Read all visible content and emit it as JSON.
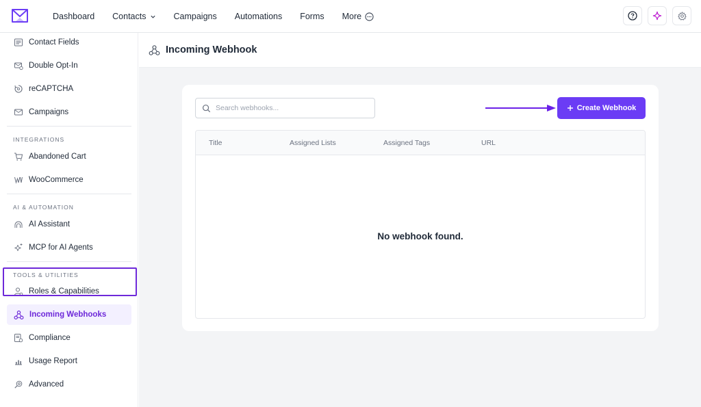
{
  "topnav": {
    "items": [
      {
        "label": "Dashboard"
      },
      {
        "label": "Contacts"
      },
      {
        "label": "Campaigns"
      },
      {
        "label": "Automations"
      },
      {
        "label": "Forms"
      },
      {
        "label": "More"
      }
    ],
    "icons": [
      "help-icon",
      "ai-sparkle-icon",
      "settings-icon"
    ]
  },
  "sidebar": {
    "items_top": [
      {
        "label": "Contact Fields",
        "icon": "contact-fields-icon"
      },
      {
        "label": "Double Opt-In",
        "icon": "double-opt-in-icon"
      },
      {
        "label": "reCAPTCHA",
        "icon": "recaptcha-icon"
      },
      {
        "label": "Campaigns",
        "icon": "envelope-icon"
      }
    ],
    "integrations_heading": "INTEGRATIONS",
    "integrations": [
      {
        "label": "Abandoned Cart",
        "icon": "cart-icon"
      },
      {
        "label": "WooCommerce",
        "icon": "woocommerce-icon"
      }
    ],
    "ai_heading": "AI & AUTOMATION",
    "ai": [
      {
        "label": "AI Assistant",
        "icon": "ai-assistant-icon"
      },
      {
        "label": "MCP for AI Agents",
        "icon": "sparkle-icon"
      }
    ],
    "tools_heading": "TOOLS & UTILITIES",
    "tools": [
      {
        "label": "Roles & Capabilities",
        "icon": "roles-icon"
      },
      {
        "label": "Incoming Webhooks",
        "icon": "webhook-icon",
        "active": true
      },
      {
        "label": "Compliance",
        "icon": "compliance-icon"
      },
      {
        "label": "Usage Report",
        "icon": "bar-chart-icon"
      },
      {
        "label": "Advanced",
        "icon": "advanced-icon"
      }
    ]
  },
  "page": {
    "title": "Incoming Webhook",
    "search_placeholder": "Search webhooks...",
    "create_button": "Create Webhook",
    "table_headers": [
      "Title",
      "Assigned Lists",
      "Assigned Tags",
      "URL"
    ],
    "empty_message": "No webhook found."
  },
  "colors": {
    "accent": "#6b3cf5",
    "active_outline": "#6d28d9"
  }
}
